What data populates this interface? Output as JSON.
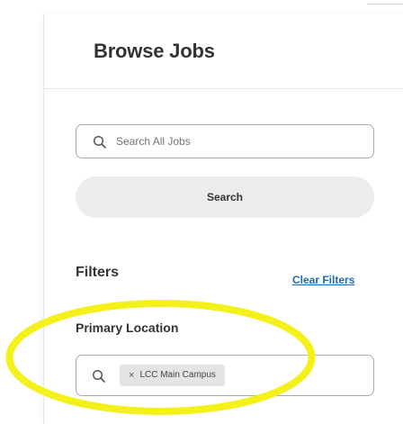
{
  "header": {
    "title": "Browse Jobs"
  },
  "search": {
    "placeholder": "Search All Jobs",
    "value": "",
    "button_label": "Search"
  },
  "filters": {
    "title": "Filters",
    "clear_label": "Clear Filters",
    "primary_location": {
      "label": "Primary Location",
      "selected_chips": [
        {
          "label": "LCC Main Campus",
          "remove_glyph": "×"
        }
      ]
    }
  },
  "icons": {
    "search": "search-icon",
    "chip_remove": "close-icon"
  },
  "colors": {
    "link": "#1d68b6",
    "highlight": "#f3f01a",
    "button_bg": "#ececec",
    "chip_bg": "#e4e4e4"
  }
}
